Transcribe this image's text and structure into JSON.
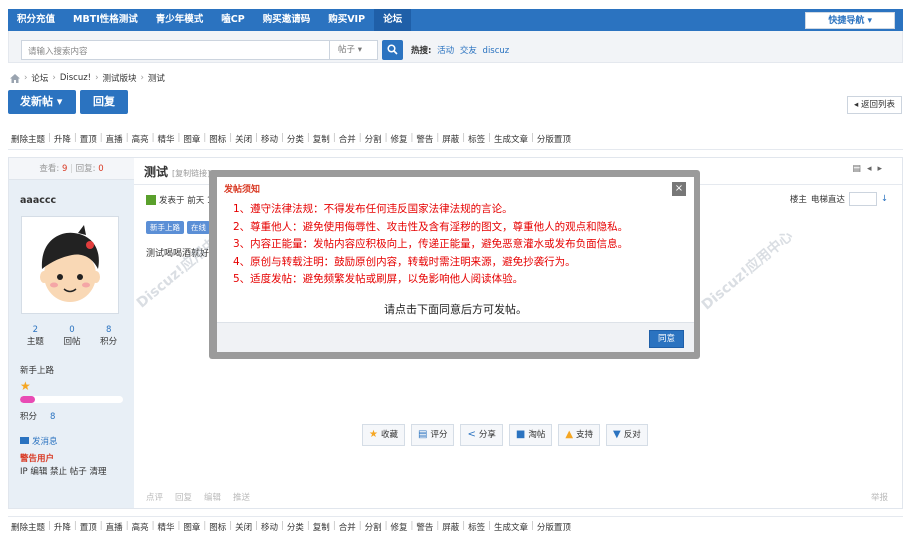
{
  "topnav": {
    "items": [
      "积分充值",
      "MBTI性格测试",
      "青少年模式",
      "嗑CP",
      "购买邀请码",
      "购买VIP",
      "论坛"
    ],
    "quick_nav": "快捷导航 ▾"
  },
  "search": {
    "placeholder": "请输入搜索内容",
    "type": "帖子 ▾",
    "hot_label": "热搜:",
    "hot_keywords": [
      "活动",
      "交友",
      "discuz"
    ]
  },
  "breadcrumb": [
    "论坛",
    "Discuz!",
    "测试版块",
    "测试"
  ],
  "buttons": {
    "post": "发新帖 ▾",
    "reply": "回复",
    "back": "◂ 返回列表"
  },
  "modbar": [
    "删除主题",
    "升降",
    "置顶",
    "直播",
    "高亮",
    "精华",
    "图章",
    "图标",
    "关闭",
    "移动",
    "分类",
    "复制",
    "合并",
    "分割",
    "修复",
    "警告",
    "屏蔽",
    "标签",
    "生成文章",
    "分版置顶"
  ],
  "post": {
    "views_label": "查看:",
    "views": "9",
    "replies_label": "回复:",
    "replies": "0",
    "title": "测试",
    "copy_link": "[复制链接]",
    "author": "aaaccc",
    "meta": "发表于 前天 13",
    "floor_label": "楼主",
    "jump_label": "电梯直达",
    "tags": [
      "新手上路",
      "在线"
    ],
    "content": "测试喝喝酒就好",
    "user_stats": [
      {
        "n": "2",
        "l": "主题"
      },
      {
        "n": "0",
        "l": "回帖"
      },
      {
        "n": "8",
        "l": "积分"
      }
    ],
    "group": "新手上路",
    "points_label": "积分",
    "points": "8",
    "progress": 0.15,
    "send_msg": "发消息",
    "warn": "警告用户",
    "admin": "IP 编辑 禁止 帖子 清理",
    "actions": [
      "收藏",
      "评分",
      "分享",
      "淘帖",
      "支持",
      "反对"
    ],
    "footer": [
      "点评",
      "回复",
      "编辑",
      "推送"
    ],
    "report": "举报"
  },
  "dialog": {
    "title": "发帖须知",
    "close": "×",
    "rules": [
      "1、遵守法律法规：不得发布任何违反国家法律法规的言论。",
      "2、尊重他人：避免使用侮辱性、攻击性及含有淫秽的图文，尊重他人的观点和隐私。",
      "3、内容正能量：发帖内容应积极向上，传递正能量，避免恶意灌水或发布负面信息。",
      "4、原创与转载注明：鼓励原创内容，转载时需注明来源，避免抄袭行为。",
      "5、适度发帖：避免频繁发帖或刷屏，以免影响他人阅读体验。"
    ],
    "notice": "请点击下面同意后方可发帖。",
    "agree": "同意"
  },
  "watermark": "Discuz!应用中心 addon.dismall.com",
  "colors": {
    "primary": "#2b73c0",
    "alert": "#e60000"
  }
}
